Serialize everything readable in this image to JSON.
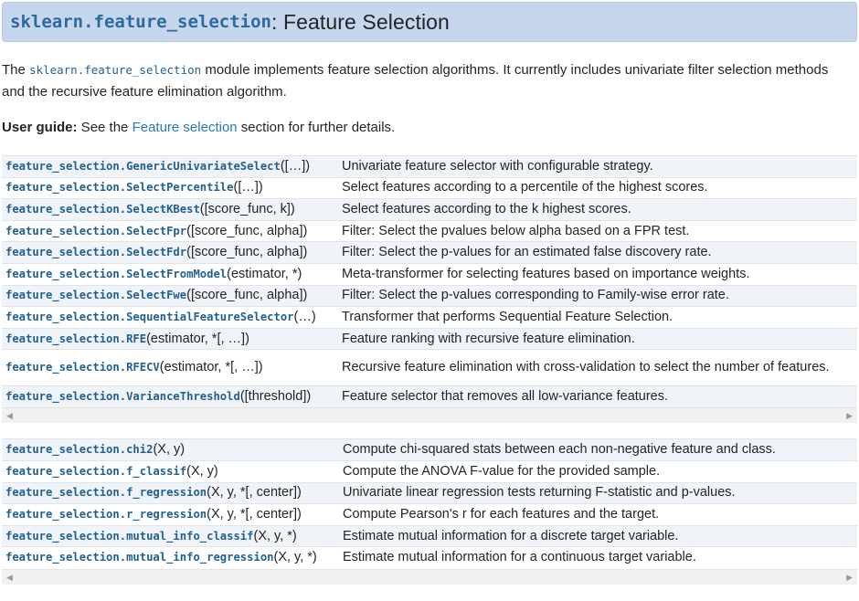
{
  "header": {
    "module": "sklearn.feature_selection",
    "title": ": Feature Selection"
  },
  "intro": {
    "before": "The ",
    "module": "sklearn.feature_selection",
    "after": " module implements feature selection algorithms. It currently includes univariate filter selection methods and the recursive feature elimination algorithm."
  },
  "guide": {
    "label": "User guide:",
    "before": " See the ",
    "link": "Feature selection",
    "after": " section for further details."
  },
  "table1": [
    {
      "fn": "feature_selection.GenericUnivariateSelect",
      "args": "([…])",
      "desc": "Univariate feature selector with configurable strategy."
    },
    {
      "fn": "feature_selection.SelectPercentile",
      "args": "([…])",
      "desc": "Select features according to a percentile of the highest scores."
    },
    {
      "fn": "feature_selection.SelectKBest",
      "args": "([score_func, k])",
      "desc": "Select features according to the k highest scores."
    },
    {
      "fn": "feature_selection.SelectFpr",
      "args": "([score_func, alpha])",
      "desc": "Filter: Select the pvalues below alpha based on a FPR test."
    },
    {
      "fn": "feature_selection.SelectFdr",
      "args": "([score_func, alpha])",
      "desc": "Filter: Select the p-values for an estimated false discovery rate."
    },
    {
      "fn": "feature_selection.SelectFromModel",
      "args": "(estimator, *)",
      "desc": "Meta-transformer for selecting features based on importance weights."
    },
    {
      "fn": "feature_selection.SelectFwe",
      "args": "([score_func, alpha])",
      "desc": "Filter: Select the p-values corresponding to Family-wise error rate."
    },
    {
      "fn": "feature_selection.SequentialFeatureSelector",
      "args": "(…)",
      "desc": "Transformer that performs Sequential Feature Selection."
    },
    {
      "fn": "feature_selection.RFE",
      "args": "(estimator, *[, …])",
      "desc": "Feature ranking with recursive feature elimination."
    },
    {
      "fn": "feature_selection.RFECV",
      "args": "(estimator, *[, …])",
      "desc": "Recursive feature elimination with cross-validation to select the number of features."
    },
    {
      "fn": "feature_selection.VarianceThreshold",
      "args": "([threshold])",
      "desc": "Feature selector that removes all low-variance features."
    }
  ],
  "table2": [
    {
      "fn": "feature_selection.chi2",
      "args": "(X, y)",
      "desc": "Compute chi-squared stats between each non-negative feature and class."
    },
    {
      "fn": "feature_selection.f_classif",
      "args": "(X, y)",
      "desc": "Compute the ANOVA F-value for the provided sample."
    },
    {
      "fn": "feature_selection.f_regression",
      "args": "(X, y, *[, center])",
      "desc": "Univariate linear regression tests returning F-statistic and p-values."
    },
    {
      "fn": "feature_selection.r_regression",
      "args": "(X, y, *[, center])",
      "desc": "Compute Pearson's r for each features and the target."
    },
    {
      "fn": "feature_selection.mutual_info_classif",
      "args": "(X, y, *)",
      "desc": "Estimate mutual information for a discrete target variable."
    },
    {
      "fn": "feature_selection.mutual_info_regression",
      "args": "(X, y, *)",
      "desc": "Estimate mutual information for a continuous target variable."
    }
  ],
  "scrollbar": {
    "left_arrow": "◀",
    "right_arrow": "▶"
  }
}
